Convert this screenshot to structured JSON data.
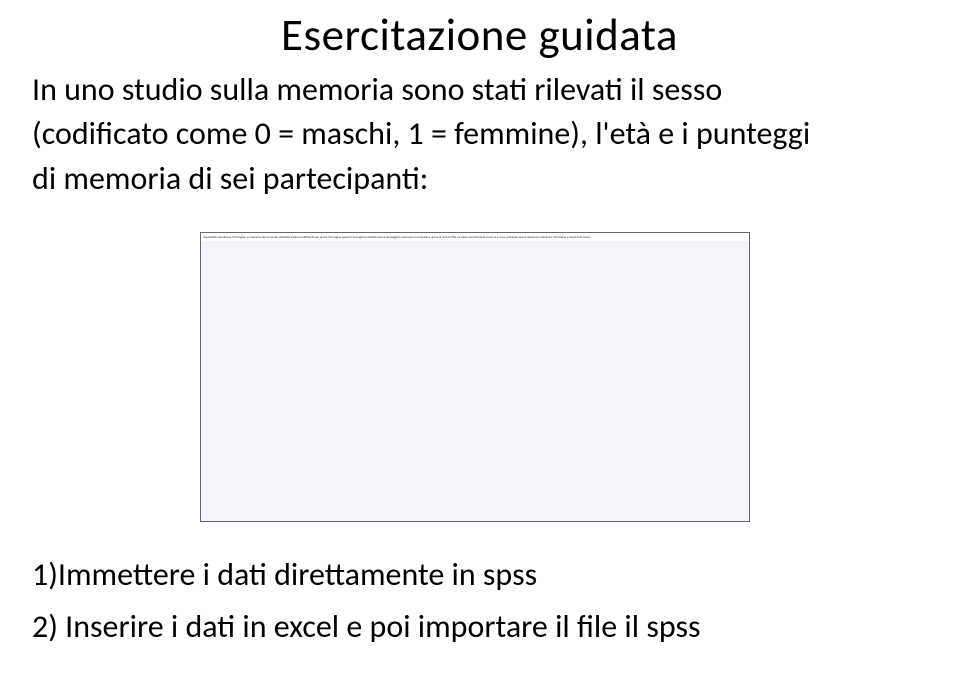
{
  "title": "Esercitazione guidata",
  "paragraph": {
    "line1": "In uno studio sulla memoria sono stati rilevati il sesso",
    "line2": "(codificato come 0 = maschi, 1 = femmine), l'età e i punteggi",
    "line3": "di memoria di sei partecipanti:"
  },
  "image_placeholder": "Impossibile visualizzare l'immagine. La memoria del computer potrebbe essere insufficiente per aprire l'immagine oppure l'immagine potrebbe essere danneggiata. Riavviare il computer e aprire di nuovo il file. Se viene visualizzata di nuovo la x rossa, potrebbe essere necessario eliminare l'immagine e inserirla di nuovo.",
  "steps": {
    "step1": "1)Immettere i dati direttamente in spss",
    "step2": "2) Inserire i dati in excel e poi importare il file il spss"
  }
}
